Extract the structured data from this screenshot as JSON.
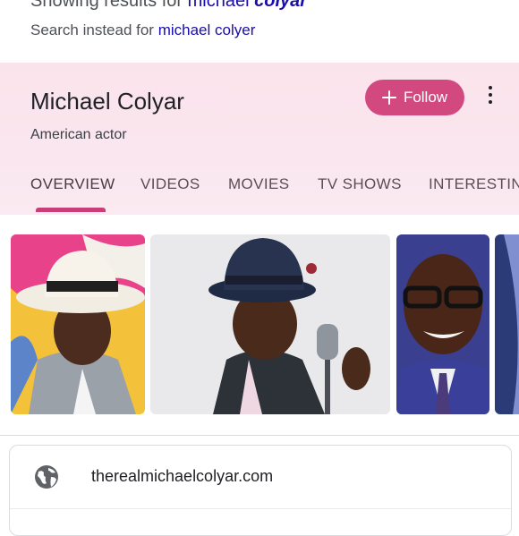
{
  "search_correction": {
    "showing_prefix": "Showing results for ",
    "corrected_query_plain": "michael ",
    "corrected_query_bold": "colyar",
    "instead_prefix": "Search instead for ",
    "original_query": "michael colyer"
  },
  "knowledge_panel": {
    "title": "Michael Colyar",
    "subtitle": "American actor",
    "follow_label": "Follow",
    "tabs": [
      {
        "label": "OVERVIEW",
        "active": true
      },
      {
        "label": "VIDEOS"
      },
      {
        "label": "MOVIES"
      },
      {
        "label": "TV SHOWS"
      },
      {
        "label": "INTERESTIN"
      }
    ],
    "accent_color": "#d2497f"
  },
  "images": {
    "count_visible": 4
  },
  "website": {
    "url": "therealmichaelcolyar.com"
  }
}
